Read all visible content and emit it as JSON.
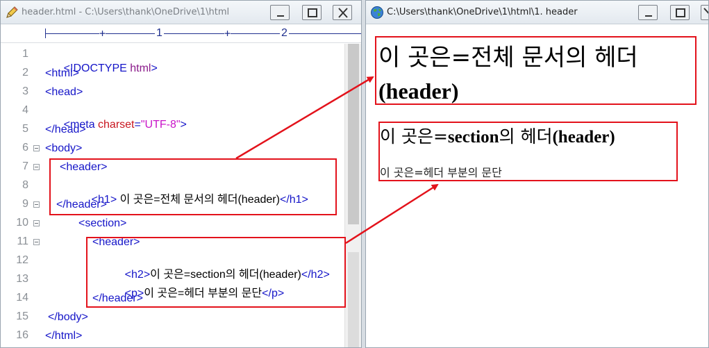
{
  "editor": {
    "title": "header.html - C:\\Users\\thank\\OneDrive\\1\\html",
    "ruler": {
      "mark1": "1",
      "mark2": "2"
    },
    "line_numbers": [
      "1",
      "2",
      "3",
      "4",
      "5",
      "6",
      "7",
      "8",
      "9",
      "10",
      "11",
      "12",
      "13",
      "14",
      "15",
      "16"
    ],
    "lines": {
      "l1": {
        "a": "<!DOCTYPE ",
        "b": "html",
        "c": ">"
      },
      "l2": "<html>",
      "l3": "<head>",
      "l4": {
        "a": "<meta ",
        "b": "charset",
        "c": "=",
        "d": "\"UTF-8\"",
        "e": ">"
      },
      "l5": "</head>",
      "l6": "<body>",
      "l7": "<header>",
      "l8": {
        "a": "<h1>",
        "b": " 이 곳은=전체 문서의 헤더(header)",
        "c": "</h1>"
      },
      "l9": "</header>",
      "l10": "<section>",
      "l11": "<header>",
      "l12": {
        "a": "<h2>",
        "b": "이 곳은=section의 헤더(header)",
        "c": "</h2>"
      },
      "l13": {
        "a": "<p>",
        "b": "이 곳은=헤더 부분의 문단",
        "c": "</p>"
      },
      "l14": "</header>",
      "l15": "</body>",
      "l16": "</html>"
    }
  },
  "browser": {
    "title": "C:\\Users\\thank\\OneDrive\\1\\html\\1. header",
    "h1_ko": "이 곳은=전체 문서의 헤더",
    "h1_en": "(header)",
    "h2_ko_a": "이 곳은=",
    "h2_en_a": "section",
    "h2_ko_b": "의 헤더",
    "h2_en_b": "(header)",
    "p": "이 곳은=헤더 부분의 문단"
  },
  "colors": {
    "tag": "#1414c8",
    "attr": "#c8141e",
    "value": "#c814c8",
    "annotation": "#e3121b"
  },
  "icons": {
    "editor": "pencil-icon",
    "browser": "globe-icon",
    "min": "minimize-icon",
    "max": "maximize-icon",
    "close": "close-icon"
  }
}
